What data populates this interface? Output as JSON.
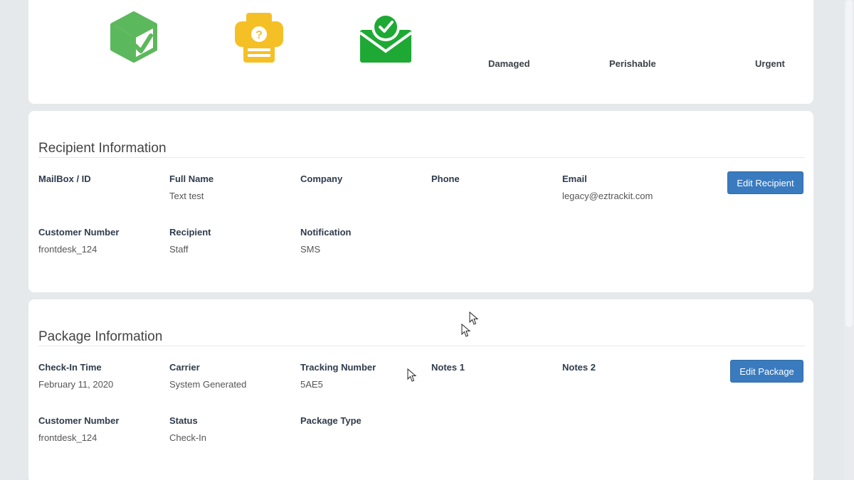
{
  "status_options": {
    "damaged_label": "Damaged",
    "perishable_label": "Perishable",
    "urgent_label": "Urgent"
  },
  "recipient": {
    "title": "Recipient Information",
    "edit_button": "Edit Recipient",
    "fields": {
      "mailbox_label": "MailBox / ID",
      "full_name_label": "Full Name",
      "full_name_value": "Text test",
      "company_label": "Company",
      "phone_label": "Phone",
      "email_label": "Email",
      "email_value": "legacy@eztrackit.com",
      "customer_number_label": "Customer Number",
      "customer_number_value": "frontdesk_124",
      "recipient_label": "Recipient",
      "recipient_value": "Staff",
      "notification_label": "Notification",
      "notification_value": "SMS"
    }
  },
  "package": {
    "title": "Package Information",
    "edit_button": "Edit Package",
    "fields": {
      "checkin_time_label": "Check-In Time",
      "checkin_time_value": "February 11, 2020",
      "carrier_label": "Carrier",
      "carrier_value": "System Generated",
      "tracking_label": "Tracking Number",
      "tracking_value": "5AE5",
      "notes1_label": "Notes 1",
      "notes2_label": "Notes 2",
      "customer_number_label": "Customer Number",
      "customer_number_value": "frontdesk_124",
      "status_label": "Status",
      "status_value": "Check-In",
      "package_type_label": "Package Type"
    }
  },
  "colors": {
    "icon_green": "#5cb85c",
    "icon_bright_green": "#1ea934",
    "icon_yellow": "#f5c026",
    "button_blue": "#3a7bbf"
  },
  "icons": {
    "box": "box-check-icon",
    "printer": "printer-question-icon",
    "envelope": "envelope-check-icon"
  }
}
